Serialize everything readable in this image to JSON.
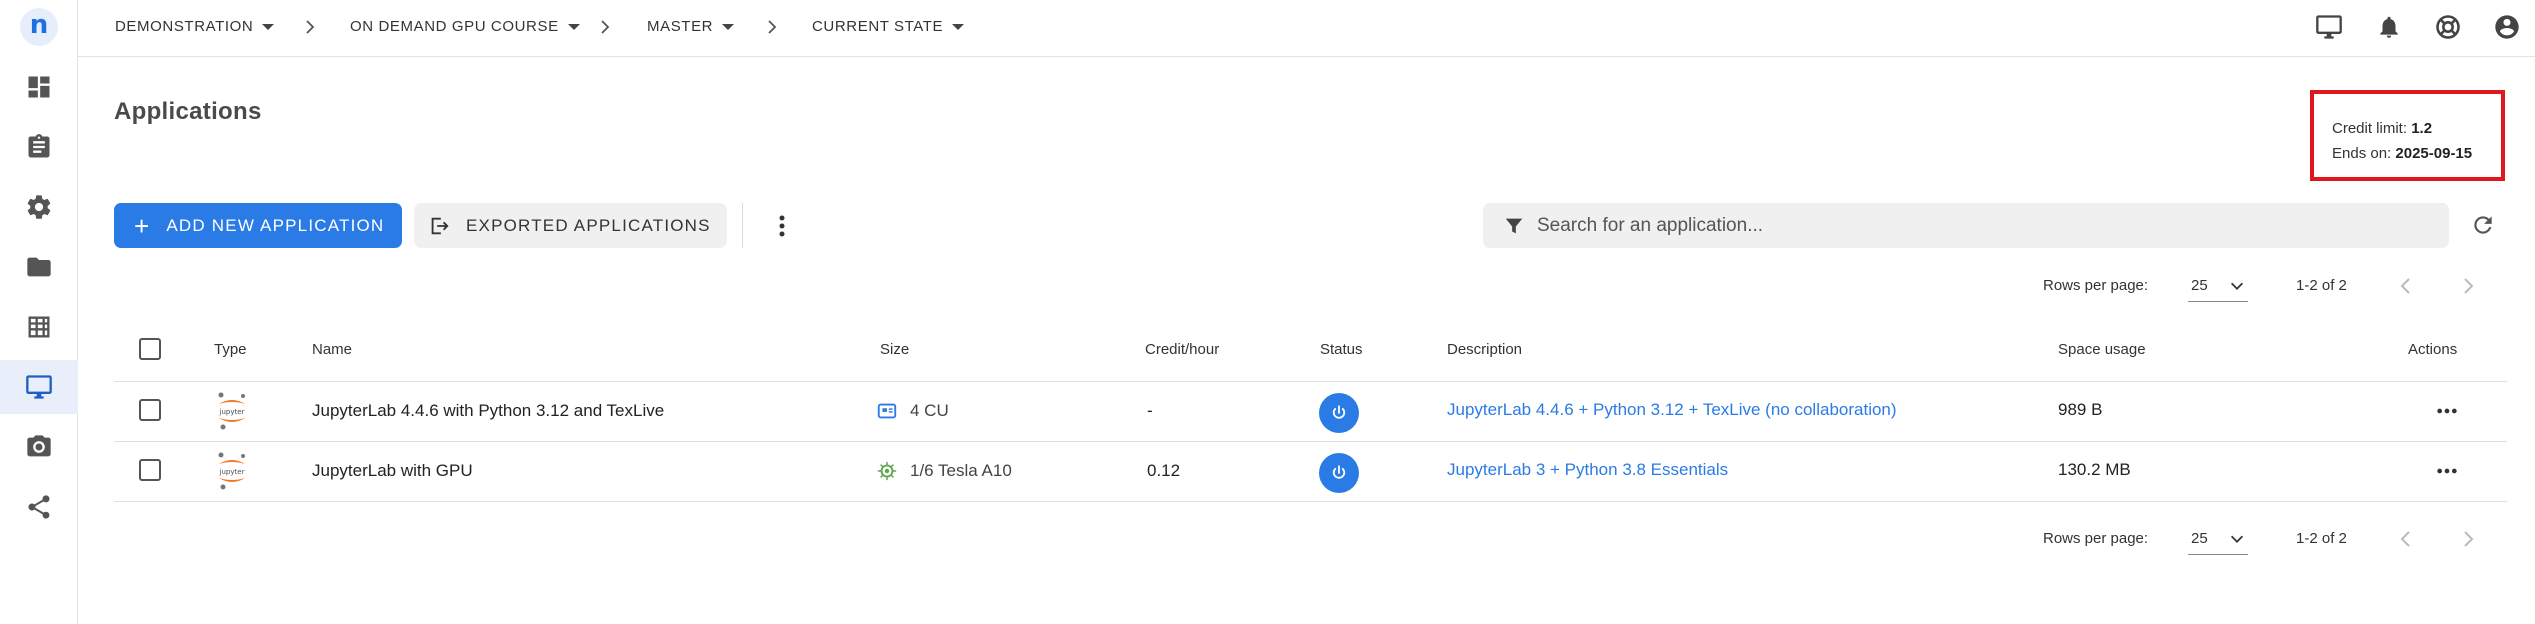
{
  "topbar": {
    "breadcrumbs": [
      {
        "label": "DEMONSTRATION"
      },
      {
        "label": "ON DEMAND GPU COURSE"
      },
      {
        "label": "MASTER"
      },
      {
        "label": "CURRENT STATE"
      }
    ]
  },
  "sidebar": {
    "logo_letter": "n",
    "items": [
      {
        "icon": "dashboard-icon"
      },
      {
        "icon": "clipboard-icon"
      },
      {
        "icon": "gear-icon"
      },
      {
        "icon": "folder-icon"
      },
      {
        "icon": "table-icon"
      },
      {
        "icon": "desktop-icon",
        "active": true
      },
      {
        "icon": "camera-icon"
      },
      {
        "icon": "share-icon"
      }
    ]
  },
  "page": {
    "title": "Applications"
  },
  "credit": {
    "limit_label": "Credit limit:",
    "limit_value": "1.2",
    "ends_label": "Ends on:",
    "ends_value": "2025-09-15"
  },
  "toolbar": {
    "add_label": "ADD NEW APPLICATION",
    "export_label": "EXPORTED APPLICATIONS",
    "search_placeholder": "Search for an application..."
  },
  "pagination": {
    "rows_label": "Rows per page:",
    "rows_value": "25",
    "range": "1-2 of 2"
  },
  "table": {
    "headers": {
      "type": "Type",
      "name": "Name",
      "size": "Size",
      "credit": "Credit/hour",
      "status": "Status",
      "description": "Description",
      "space": "Space usage",
      "actions": "Actions"
    },
    "rows": [
      {
        "name": "JupyterLab 4.4.6 with Python 3.12 and TexLive",
        "size": "4 CU",
        "size_icon": "cpu-icon",
        "credit": "-",
        "description": "JupyterLab 4.4.6 + Python 3.12 + TexLive (no collaboration)",
        "space": "989 B"
      },
      {
        "name": "JupyterLab with GPU",
        "size": "1/6 Tesla A10",
        "size_icon": "gpu-icon",
        "credit": "0.12",
        "description": "JupyterLab 3 + Python 3.8 Essentials",
        "space": "130.2 MB"
      }
    ]
  },
  "colors": {
    "accent": "#2b7be6",
    "highlight_border": "#e0181e",
    "gpu_green": "#5aa84a"
  }
}
